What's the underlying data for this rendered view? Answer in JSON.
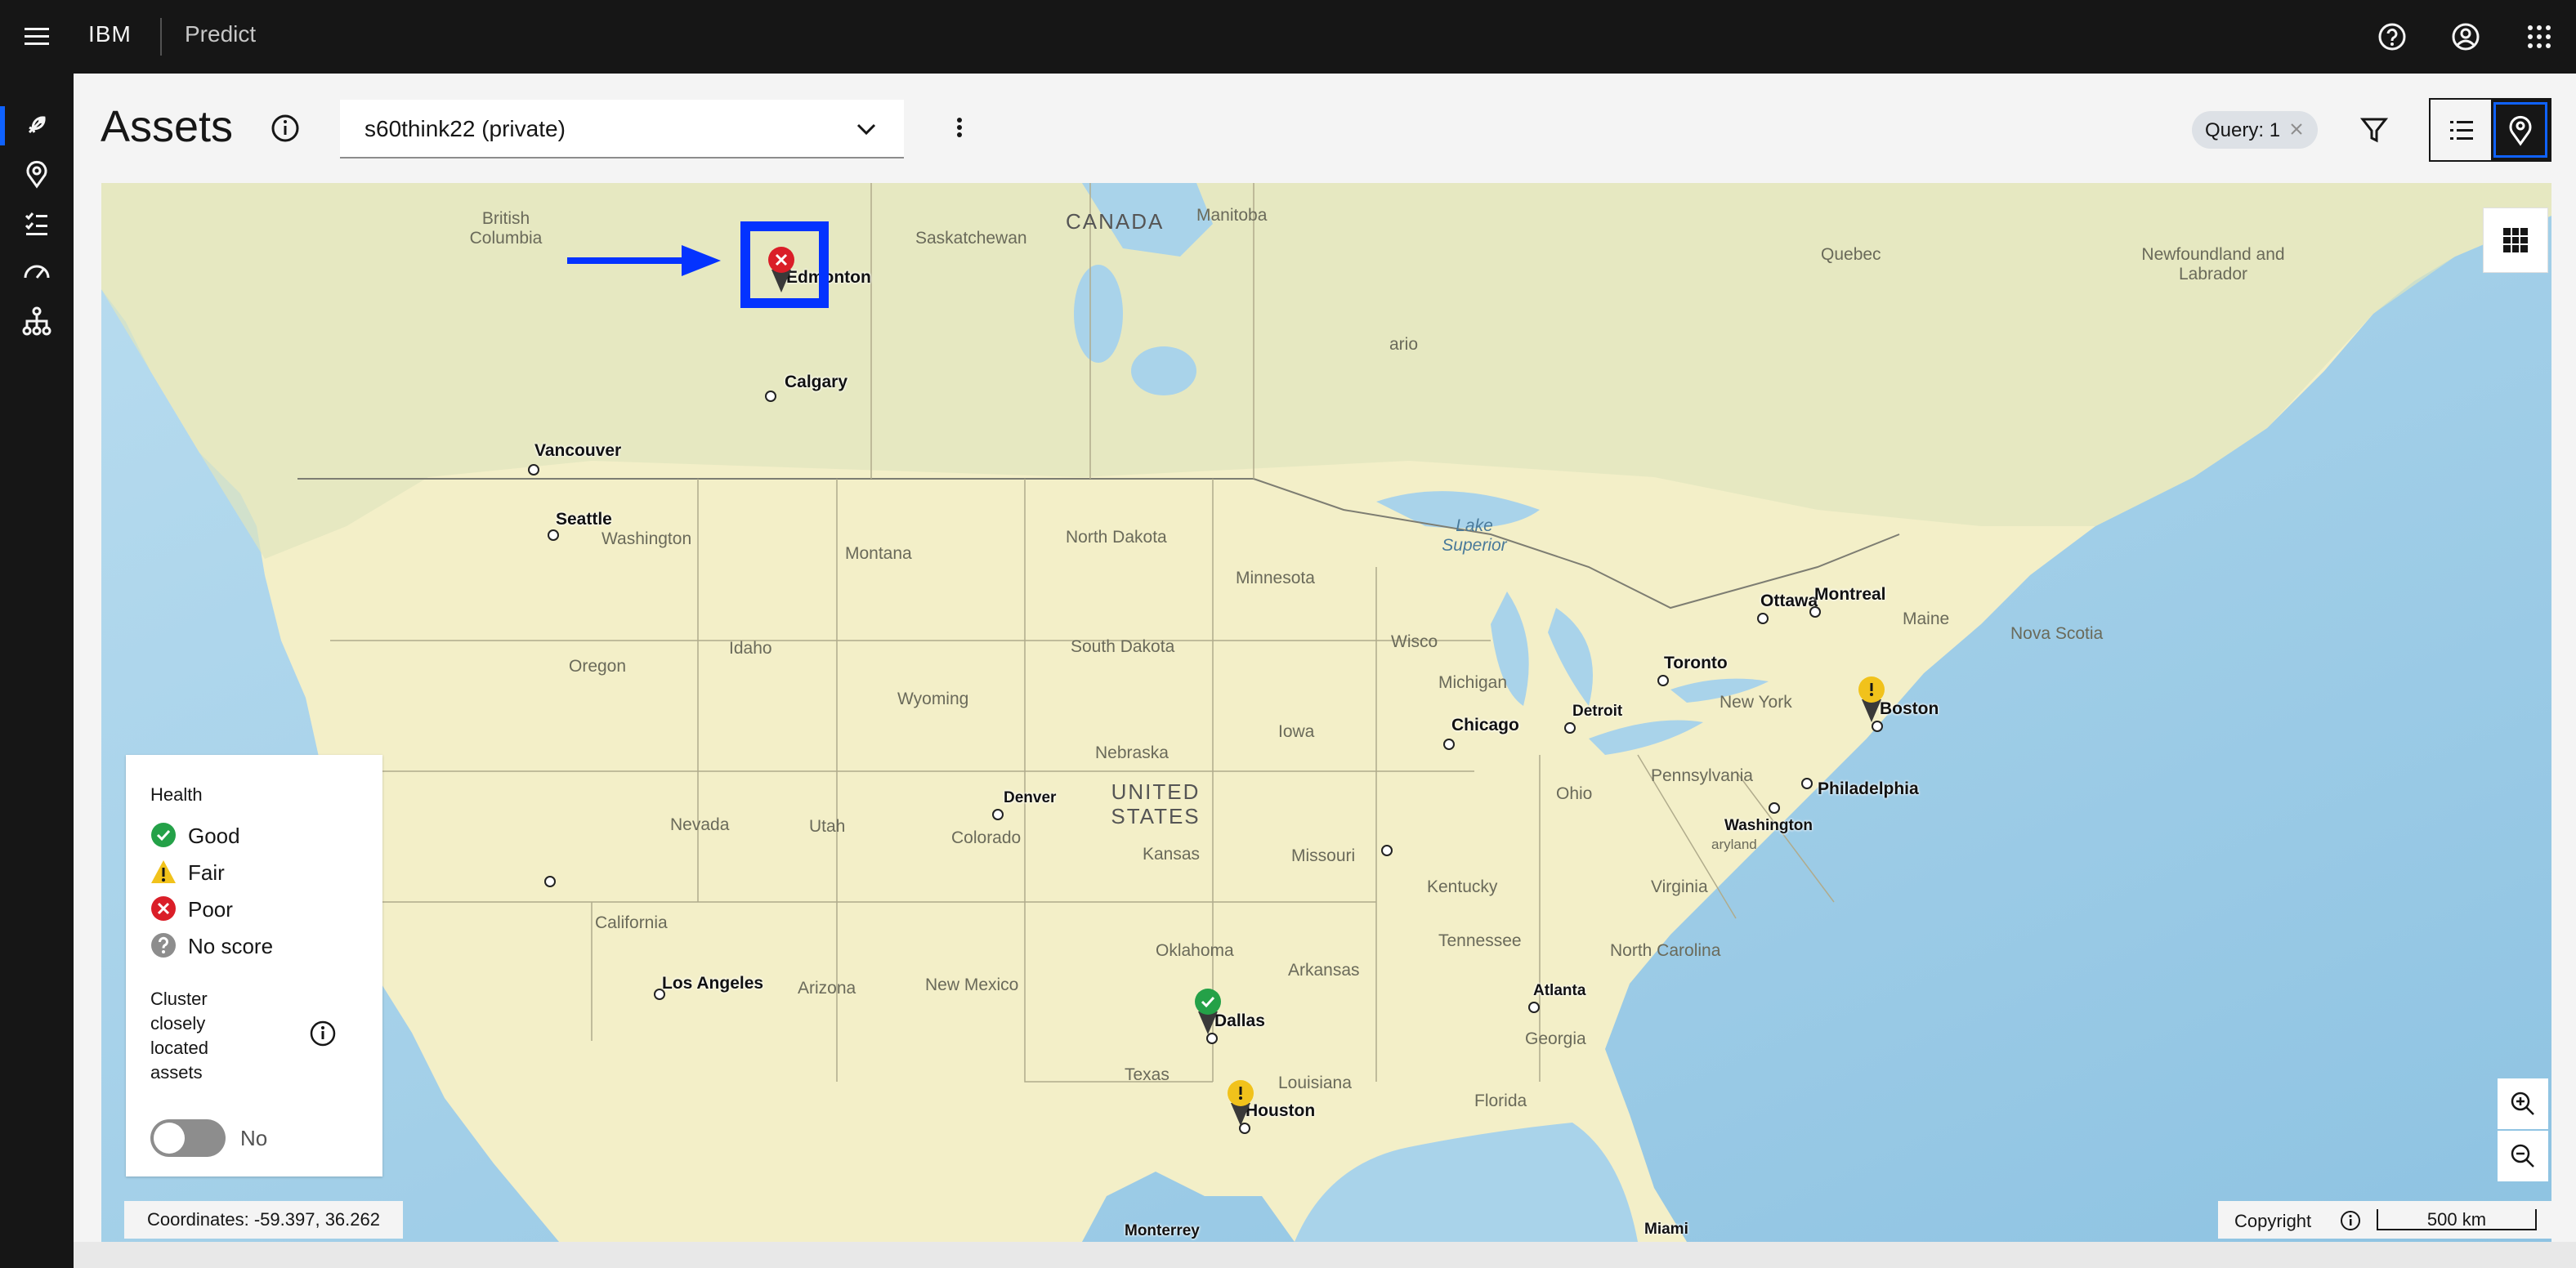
{
  "header": {
    "menu_icon": "hamburger-icon",
    "brand": "IBM",
    "product": "Predict",
    "icons": [
      "help-icon",
      "user-avatar-icon",
      "app-switcher-icon"
    ]
  },
  "rail": {
    "items": [
      {
        "name": "rocket-icon",
        "active": true
      },
      {
        "name": "location-icon",
        "active": false
      },
      {
        "name": "checklist-icon",
        "active": false
      },
      {
        "name": "dashboard-icon",
        "active": false
      },
      {
        "name": "hierarchy-icon",
        "active": false
      }
    ]
  },
  "page": {
    "title": "Assets",
    "dropdown_value": "s60think22 (private)",
    "query_tag": "Query: 1"
  },
  "map": {
    "countries": [
      "CANADA",
      "UNITED STATES"
    ],
    "regions": [
      "British Columbia",
      "Saskatchewan",
      "Manitoba",
      "Quebec",
      "Newfoundland and Labrador",
      "ario",
      "North Dakota",
      "Minnesota",
      "Montana",
      "South Dakota",
      "Wyoming",
      "Idaho",
      "Oregon",
      "Washington",
      "Nebraska",
      "Iowa",
      "Wisco",
      "Michigan",
      "Lake Superior",
      "Maine",
      "Nova Scotia",
      "New York",
      "Pennsylvania",
      "Ohio",
      "Nevada",
      "Utah",
      "Colorado",
      "Kansas",
      "Missouri",
      "Kentucky",
      "Virginia",
      "California",
      "Arizona",
      "New Mexico",
      "Oklahoma",
      "Arkansas",
      "Tennessee",
      "North Carolina",
      "Georgia",
      "Louisiana",
      "Texas",
      "Florida",
      "aryland"
    ],
    "cities": [
      "Edmonton",
      "Calgary",
      "Vancouver",
      "Seattle",
      "Ottawa",
      "Montreal",
      "Toronto",
      "Boston",
      "Chicago",
      "Detroit",
      "Philadelphia",
      "Washington",
      "Denver",
      "Los Angeles",
      "Atlanta",
      "Dallas",
      "Houston",
      "Monterrey",
      "Miami"
    ],
    "pins": [
      {
        "city": "Edmonton",
        "status": "poor"
      },
      {
        "city": "Boston",
        "status": "fair"
      },
      {
        "city": "Dallas",
        "status": "good"
      },
      {
        "city": "Houston",
        "status": "fair"
      }
    ],
    "coordinates": "Coordinates: -59.397, 36.262",
    "copyright": "Copyright",
    "scale": "500 km"
  },
  "legend": {
    "heading": "Health",
    "items": [
      {
        "label": "Good",
        "icon": "checkmark-filled-icon",
        "color": "#24a148"
      },
      {
        "label": "Fair",
        "icon": "warning-filled-icon",
        "color": "#f1c21b"
      },
      {
        "label": "Poor",
        "icon": "error-filled-icon",
        "color": "#da1e28"
      },
      {
        "label": "No score",
        "icon": "help-filled-icon",
        "color": "#8d8d8d"
      }
    ],
    "cluster_label": "Cluster closely located assets",
    "toggle_state": "No"
  },
  "colors": {
    "water": "#a9d3ea",
    "land": "#f3efc8",
    "accent": "#0f62fe",
    "annotation": "#0433ff"
  }
}
